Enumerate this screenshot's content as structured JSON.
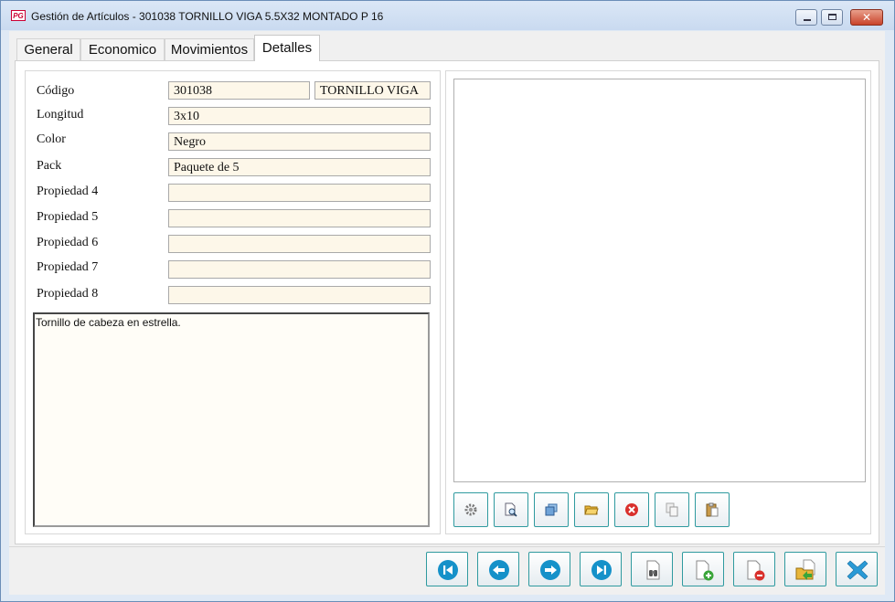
{
  "window": {
    "title": "Gestión de Artículos - 301038 TORNILLO VIGA 5.5X32 MONTADO P 16",
    "app_icon_text": "PG"
  },
  "tabs": [
    {
      "label": "General",
      "active": false
    },
    {
      "label": "Economico",
      "active": false
    },
    {
      "label": "Movimientos",
      "active": false
    },
    {
      "label": "Detalles",
      "active": true
    }
  ],
  "details": {
    "codigo_label": "Código",
    "codigo_value": "301038",
    "descripcion_value": "TORNILLO VIGA",
    "longitud_label": "Longitud",
    "longitud_value": "3x10",
    "color_label": "Color",
    "color_value": "Negro",
    "pack_label": "Pack",
    "pack_value": "Paquete de 5",
    "propiedad4_label": "Propiedad 4",
    "propiedad4_value": "",
    "propiedad5_label": "Propiedad 5",
    "propiedad5_value": "",
    "propiedad6_label": "Propiedad 6",
    "propiedad6_value": "",
    "propiedad7_label": "Propiedad 7",
    "propiedad7_value": "",
    "propiedad8_label": "Propiedad 8",
    "propiedad8_value": "",
    "notes": "Tornillo de cabeza en estrella."
  },
  "image_toolbar": [
    "gear-icon",
    "zoom-preview-icon",
    "cascade-windows-icon",
    "open-folder-icon",
    "delete-icon",
    "copy-icon",
    "paste-icon"
  ],
  "nav_toolbar": [
    "first-record-icon",
    "previous-record-icon",
    "next-record-icon",
    "last-record-icon",
    "search-binoculars-icon",
    "new-record-icon",
    "delete-record-icon",
    "export-icon",
    "close-icon"
  ],
  "colors": {
    "field_background": "#fdf7e9",
    "button_border": "#2f9a9f",
    "nav_arrow": "#1591c9",
    "close_x": "#2a9ad6"
  }
}
